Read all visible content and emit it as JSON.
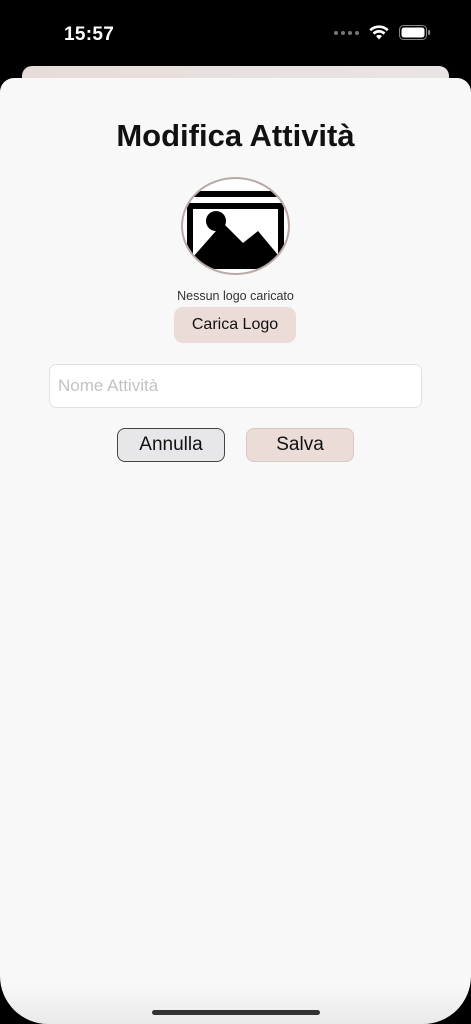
{
  "status_bar": {
    "time": "15:57",
    "icons": [
      "cellular-dots-icon",
      "wifi-icon",
      "battery-icon"
    ]
  },
  "sheet": {
    "title": "Modifica Attività",
    "logo": {
      "icon": "image-placeholder-icon",
      "caption": "Nessun logo caricato",
      "upload_label": "Carica Logo"
    },
    "name_field": {
      "value": "",
      "placeholder": "Nome Attività"
    },
    "actions": {
      "cancel_label": "Annulla",
      "save_label": "Salva"
    }
  },
  "colors": {
    "accent_button": "#ebdcd8",
    "sheet_background": "#f8f8f8",
    "cancel_button": "#e7e7ea"
  }
}
